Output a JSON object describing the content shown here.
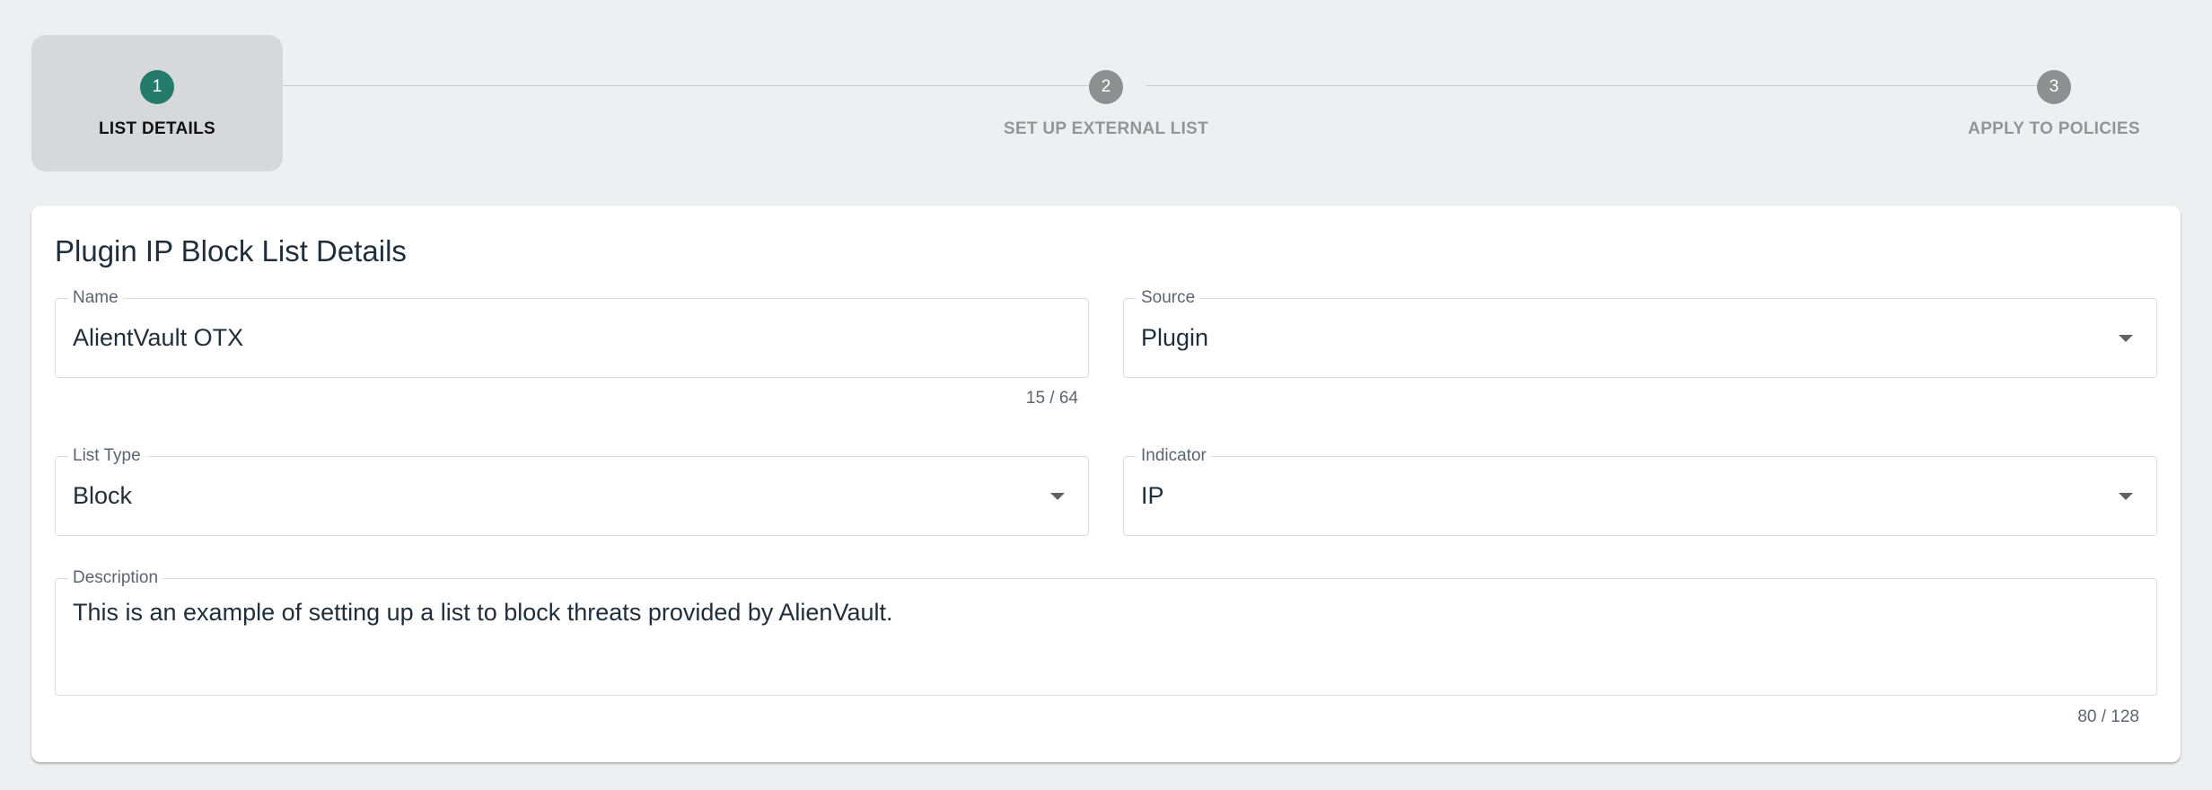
{
  "stepper": {
    "steps": [
      {
        "number": "1",
        "label": "LIST DETAILS"
      },
      {
        "number": "2",
        "label": "SET UP EXTERNAL LIST"
      },
      {
        "number": "3",
        "label": "APPLY TO POLICIES"
      }
    ],
    "active_step": 1,
    "active_color": "#247a6b",
    "inactive_color": "#8e8f91"
  },
  "card": {
    "title": "Plugin IP Block List Details",
    "name": {
      "label": "Name",
      "value": "AlientVault OTX",
      "counter": "15 / 64"
    },
    "source": {
      "label": "Source",
      "value": "Plugin",
      "icon": "chevron-down-icon"
    },
    "list_type": {
      "label": "List Type",
      "value": "Block",
      "icon": "chevron-down-icon"
    },
    "indicator": {
      "label": "Indicator",
      "value": "IP",
      "icon": "chevron-down-icon"
    },
    "description": {
      "label": "Description",
      "value": "This is an example of setting up a list to block threats provided by AlienVault.",
      "counter": "80 / 128"
    }
  }
}
